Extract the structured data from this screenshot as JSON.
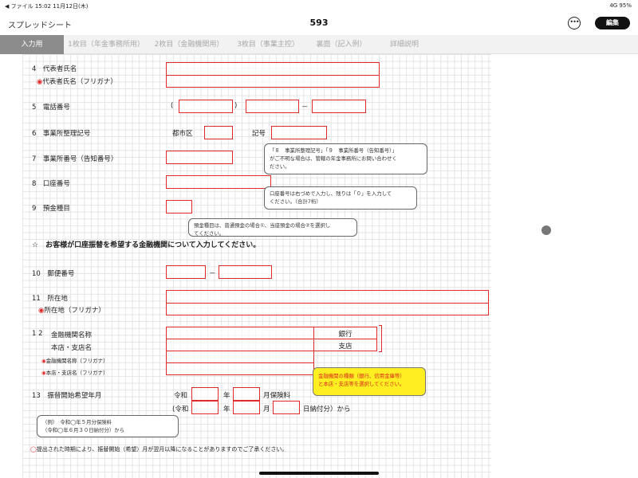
{
  "status": {
    "left": "◀ ファイル  15:02  11月12日(木)",
    "right": "4G  95%"
  },
  "app": {
    "title": "スプレッドシート",
    "doc_title": "593",
    "more_label": "•••",
    "edit_label": "編集"
  },
  "tabs": [
    {
      "label": "入力用",
      "active": true
    },
    {
      "label": "1枚目（年金事務所用）"
    },
    {
      "label": "2枚目（金融機関用）"
    },
    {
      "label": "3枚目（事業主控）"
    },
    {
      "label": "裏面（記入例）"
    },
    {
      "label": "詳細説明"
    }
  ],
  "form": {
    "rep_name": "4　代表者氏名",
    "rep_kana": "代表者氏名（フリガナ）",
    "phone": "5　電話番号",
    "paren_open": "(",
    "paren_close": ")",
    "dash": "－",
    "office_code": "6　事業所整理記号",
    "city_label": "都市区",
    "code_label": "記号",
    "office_no": "7　事業所番号（告知番号）",
    "account_no": "8　口座番号",
    "deposit_type": "9　預金種目",
    "star_heading": "☆　お客様が口座振替を希望する金融機関について入力してください。",
    "postal": "10　郵便番号",
    "address": "11　所在地",
    "address_kana": "所在地（フリガナ）",
    "bank_no": "1 2",
    "bank_name": "金融機関名称",
    "branch_name": "本店・支店名",
    "bank_kana": "金融機関名称（フリガナ）",
    "branch_kana": "本店・支店名（フリガナ）",
    "bank_suffix": "銀行",
    "branch_suffix": "支店",
    "start_month": "13　振替開始希望年月",
    "era1": "令和",
    "era2": "(令和",
    "year": "年",
    "month_fee": "月保険料",
    "month": "月",
    "day_paid": "日納付分）から",
    "footnote": "提出された時期により、振替開始（希望）月が翌月以降になることがありますのでご了承ください。"
  },
  "callouts": {
    "office": "「８　事業所整理記号」「９　事業所番号（告知番号）」\nがご不明な場合は、管轄の年金事務所にお問い合わせく\nださい。",
    "account": "口座番号は右づめで入力し、残りは「０」を入力して\nください。（合計7桁）",
    "deposit": "預金種目は、普通預金の場合①、当座預金の場合②を選択し\nてください。",
    "bank": "金融機関の種類（銀行、信用金庫等）\nと本店・支店等を選択してください。",
    "example": "（例）　令和◯年５月分保険料\n（令和◯年６月３０日納付分）から"
  },
  "colors": {
    "accent_red": "#e02a2a",
    "callout_yellow": "#ffee22",
    "tab_active": "#8c8c8c"
  }
}
